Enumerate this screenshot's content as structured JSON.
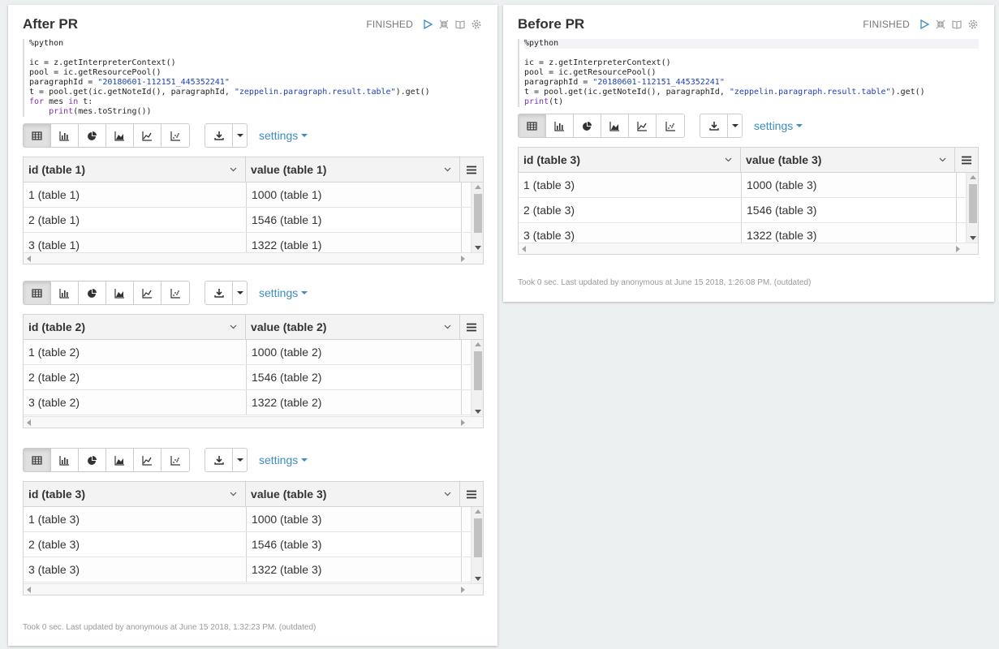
{
  "after": {
    "title": "After PR",
    "status": "FINISHED",
    "code": [
      "%python",
      "",
      "ic = z.getInterpreterContext()",
      "pool = ic.getResourcePool()",
      "paragraphId = \"20180601-112151_445352241\"",
      "t = pool.get(ic.getNoteId(), paragraphId, \"zeppelin.paragraph.result.table\").get()",
      "for mes in t:",
      "    print(mes.toString())"
    ],
    "tables": [
      {
        "headers": [
          "id (table 1)",
          "value (table 1)"
        ],
        "rows": [
          [
            "1 (table 1)",
            "1000 (table 1)"
          ],
          [
            "2 (table 1)",
            "1546 (table 1)"
          ],
          [
            "3 (table 1)",
            "1322 (table 1)"
          ]
        ]
      },
      {
        "headers": [
          "id (table 2)",
          "value (table 2)"
        ],
        "rows": [
          [
            "1 (table 2)",
            "1000 (table 2)"
          ],
          [
            "2 (table 2)",
            "1546 (table 2)"
          ],
          [
            "3 (table 2)",
            "1322 (table 2)"
          ]
        ]
      },
      {
        "headers": [
          "id (table 3)",
          "value (table 3)"
        ],
        "rows": [
          [
            "1 (table 3)",
            "1000 (table 3)"
          ],
          [
            "2 (table 3)",
            "1546 (table 3)"
          ],
          [
            "3 (table 3)",
            "1322 (table 3)"
          ]
        ]
      }
    ],
    "footer": "Took 0 sec. Last updated by anonymous at June 15 2018, 1:32:23 PM. (outdated)"
  },
  "before": {
    "title": "Before PR",
    "status": "FINISHED",
    "code": [
      "%python",
      "",
      "ic = z.getInterpreterContext()",
      "pool = ic.getResourcePool()",
      "paragraphId = \"20180601-112151_445352241\"",
      "t = pool.get(ic.getNoteId(), paragraphId, \"zeppelin.paragraph.result.table\").get()",
      "print(t)"
    ],
    "table": {
      "headers": [
        "id (table 3)",
        "value (table 3)"
      ],
      "rows": [
        [
          "1 (table 3)",
          "1000 (table 3)"
        ],
        [
          "2 (table 3)",
          "1546 (table 3)"
        ],
        [
          "3 (table 3)",
          "1322 (table 3)"
        ]
      ]
    },
    "footer": "Took 0 sec. Last updated by anonymous at June 15 2018, 1:26:08 PM. (outdated)"
  },
  "settings_label": "settings",
  "icons": {
    "run": "play-icon",
    "hide_editor": "compress-icon",
    "hide_output": "book-icon",
    "settings": "gear-icon",
    "vis": [
      "table-icon",
      "bar-chart-icon",
      "pie-chart-icon",
      "area-chart-icon",
      "line-chart-icon",
      "scatter-chart-icon"
    ],
    "download": "download-icon",
    "column_menu": "hamburger-menu-icon"
  },
  "colors": {
    "accent": "#3c8dbc",
    "background": "#ecf0f1",
    "keyword": "#7c2fb8",
    "string": "#1d41b5"
  }
}
